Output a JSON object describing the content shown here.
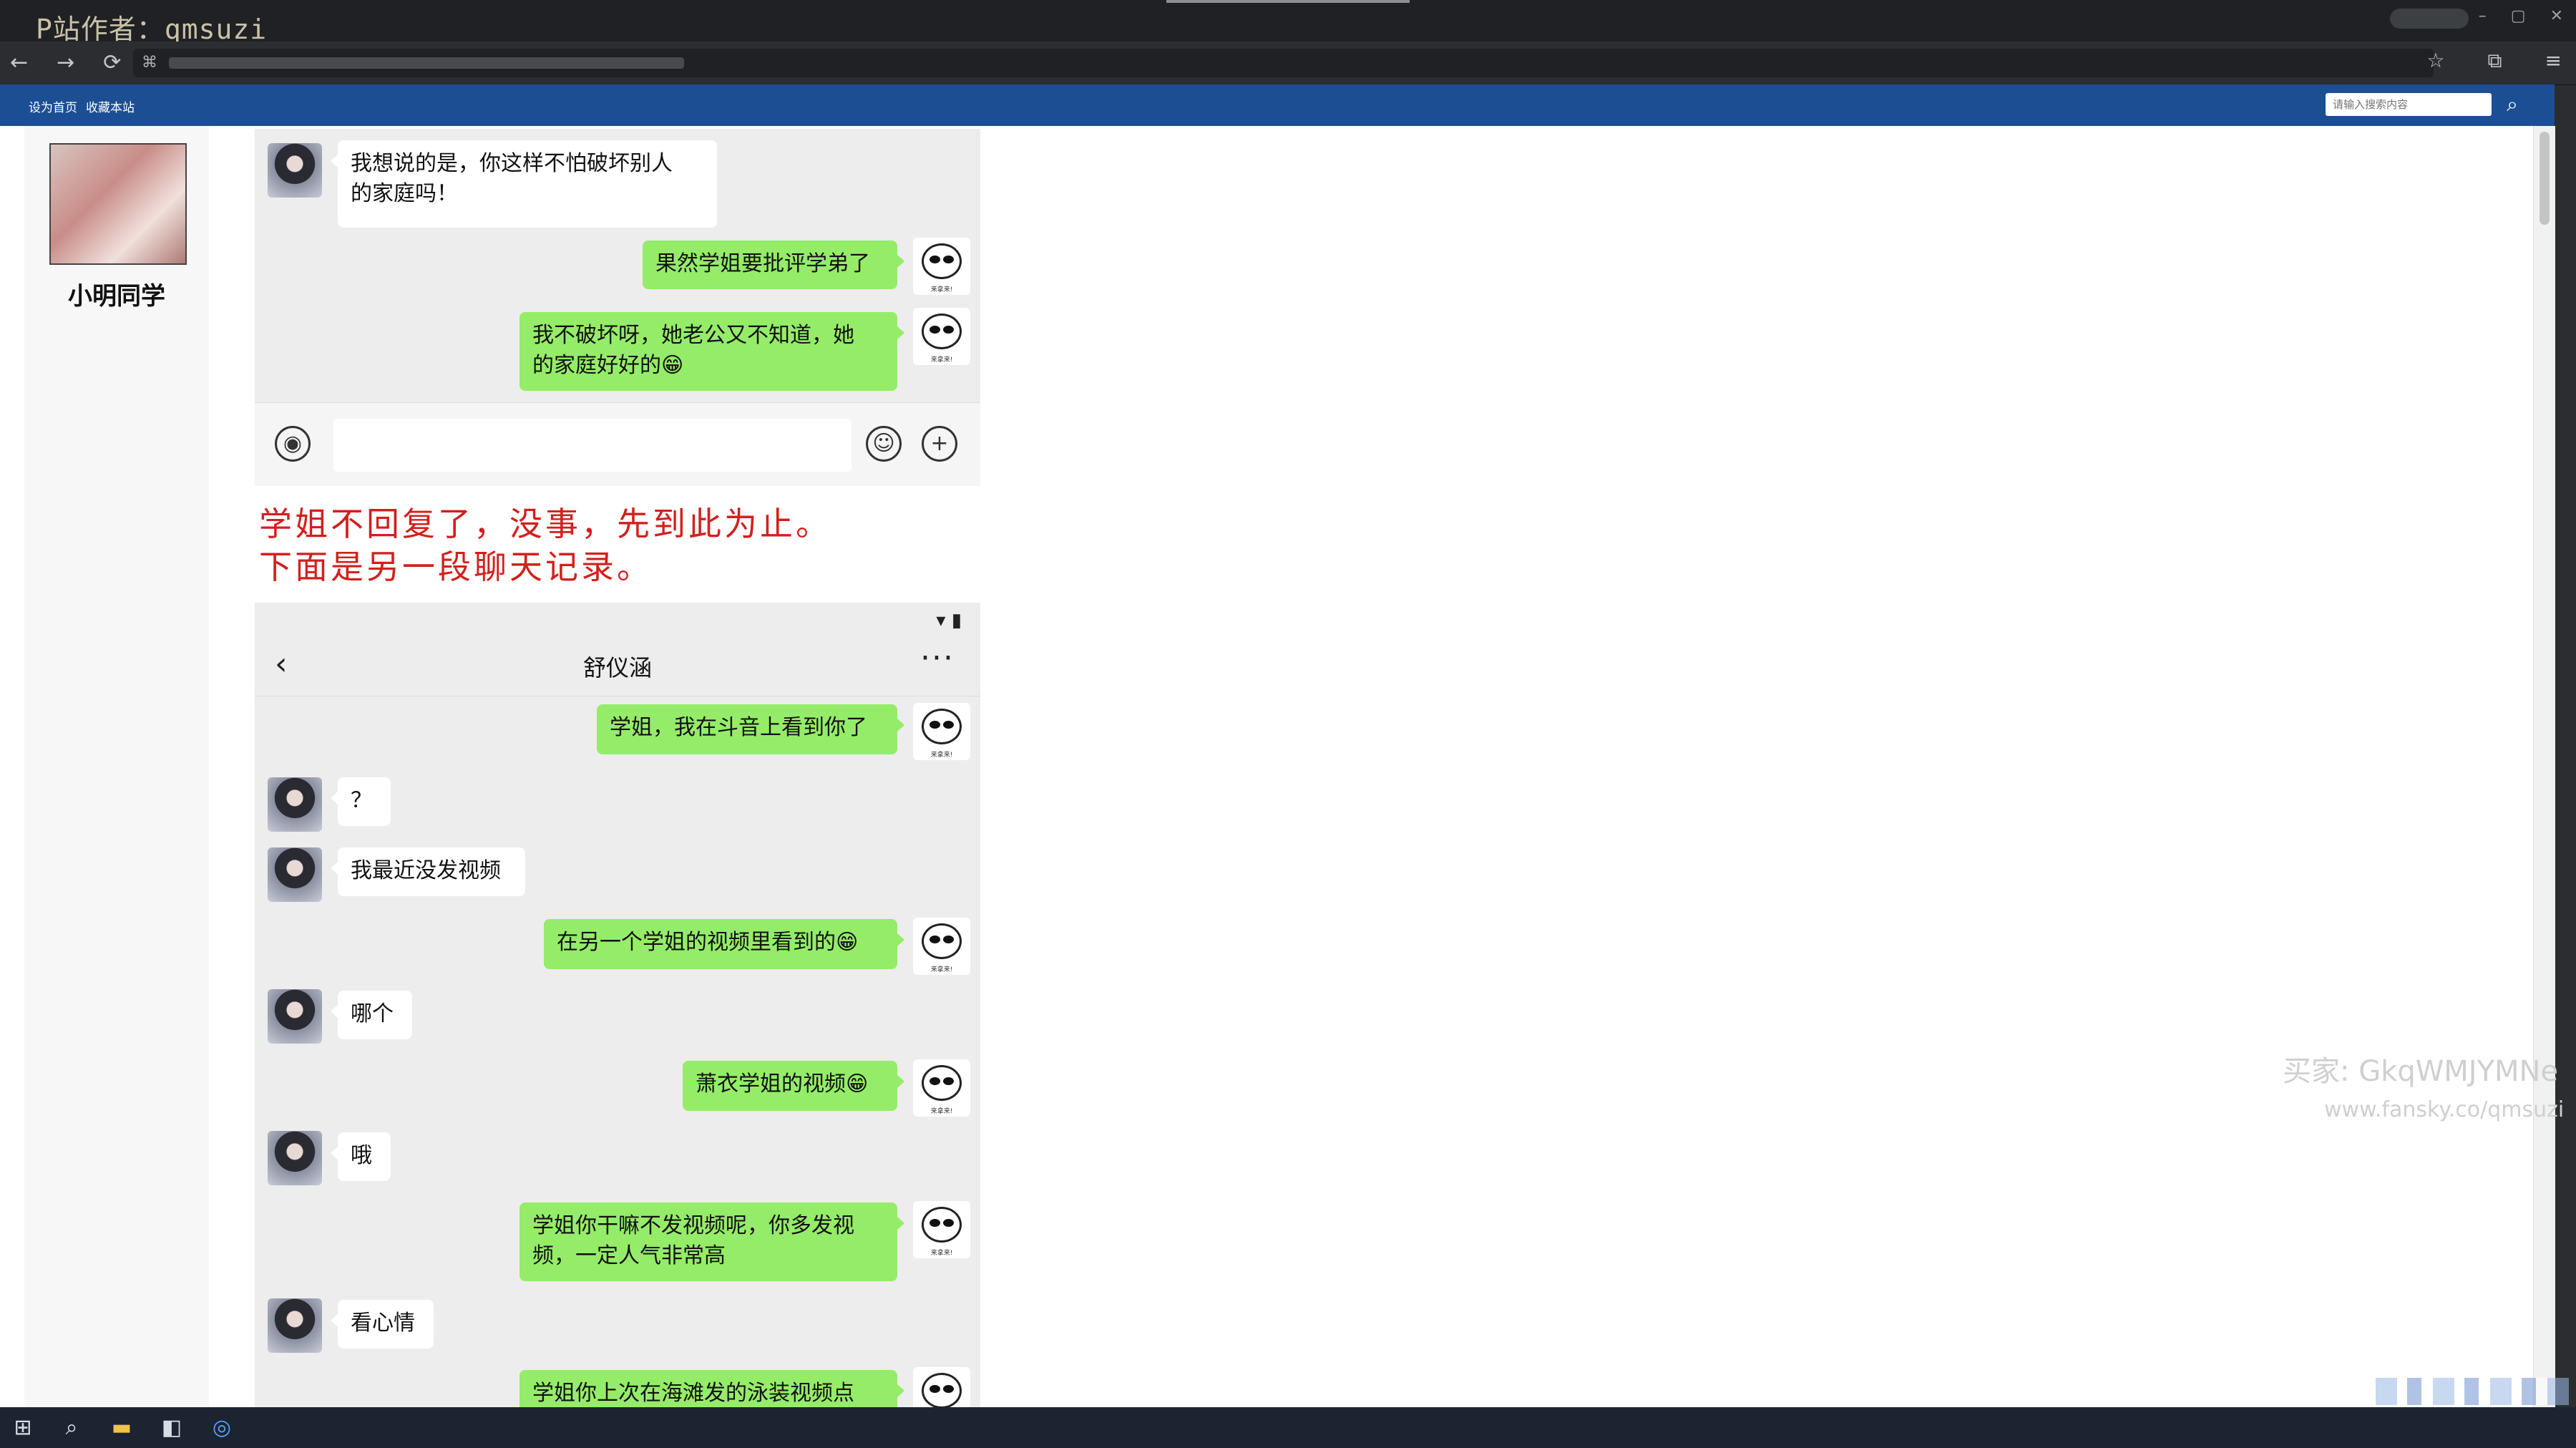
{
  "watermark_top": "P站作者：qmsuzi",
  "window_controls": [
    "–",
    "▢",
    "✕"
  ],
  "nav": {
    "back": "←",
    "forward": "→",
    "reload": "⟳"
  },
  "site": {
    "links": [
      "设为首页",
      "收藏本站"
    ],
    "search_placeholder": "请输入搜索内容",
    "search_icon": "magnifier"
  },
  "profile": {
    "name": "小明同学"
  },
  "chat1": {
    "messages": [
      {
        "side": "in",
        "text": "我想说的是，你这样不怕破坏别人\n的家庭吗！"
      },
      {
        "side": "out",
        "text": "果然学姐要批评学弟了"
      },
      {
        "side": "out",
        "text": "我不破坏呀，她老公又不知道，她\n的家庭好好的😁"
      }
    ]
  },
  "note": [
    "学姐不回复了，没事，先到此为止。",
    "下面是另一段聊天记录。"
  ],
  "chat2": {
    "status_icons": "▾ ▮",
    "title": "舒仪涵",
    "back": "‹",
    "more": "···",
    "messages": [
      {
        "side": "out",
        "text": "学姐，我在斗音上看到你了"
      },
      {
        "side": "in",
        "text": "？"
      },
      {
        "side": "in",
        "text": "我最近没发视频"
      },
      {
        "side": "out",
        "text": "在另一个学姐的视频里看到的😁"
      },
      {
        "side": "in",
        "text": "哪个"
      },
      {
        "side": "out",
        "text": "萧衣学姐的视频😁"
      },
      {
        "side": "in",
        "text": "哦"
      },
      {
        "side": "out",
        "text": "学姐你干嘛不发视频呢，你多发视\n频，一定人气非常高"
      },
      {
        "side": "in",
        "text": "看心情"
      },
      {
        "side": "out",
        "text": "学姐你上次在海滩发的泳装视频点"
      }
    ]
  },
  "watermark_right": {
    "line1": "买家: GkqWMJYMNe",
    "line2": "www.fansky.co/qmsuzi"
  },
  "panda_caption": "来拿来!"
}
